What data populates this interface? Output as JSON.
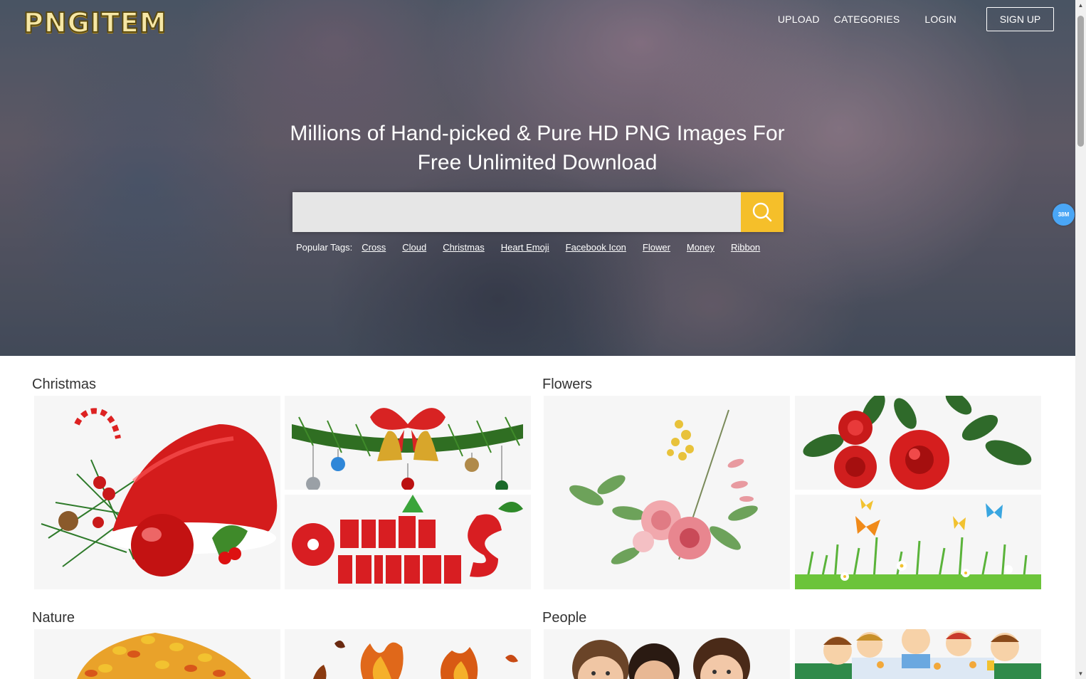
{
  "header": {
    "logo_text": "PNGITEM",
    "nav": {
      "upload": "UPLOAD",
      "categories": "CATEGORIES",
      "login": "LOGIN",
      "signup": "SIGN UP"
    }
  },
  "hero": {
    "headline": "Millions of Hand-picked & Pure HD PNG Images For Free Unlimited Download",
    "search": {
      "value": "",
      "placeholder": ""
    },
    "popular_tags_label": "Popular Tags:",
    "tags": [
      "Cross",
      "Cloud",
      "Christmas",
      "Heart Emoji",
      "Facebook Icon",
      "Flower",
      "Money",
      "Ribbon"
    ]
  },
  "badge": {
    "text": "38M"
  },
  "sections": [
    {
      "title": "Christmas",
      "tiles": [
        "santa-hat-ornament-image",
        "bells-bow-garland-image",
        "merry-christmas-lettering-image"
      ]
    },
    {
      "title": "Flowers",
      "tiles": [
        "watercolor-bouquet-image",
        "red-roses-image",
        "butterflies-grass-image"
      ]
    },
    {
      "title": "Nature",
      "tiles": [
        "autumn-leaves-pile-image",
        "fire-flames-image"
      ]
    },
    {
      "title": "People",
      "tiles": [
        "children-faces-image",
        "cartoon-family-dinner-image"
      ]
    }
  ],
  "colors": {
    "accent": "#f5bf2a",
    "badge": "#4aa6f5",
    "section_title": "#333333"
  },
  "icons": [
    "search-icon",
    "scroll-up-icon",
    "scroll-down-icon"
  ]
}
